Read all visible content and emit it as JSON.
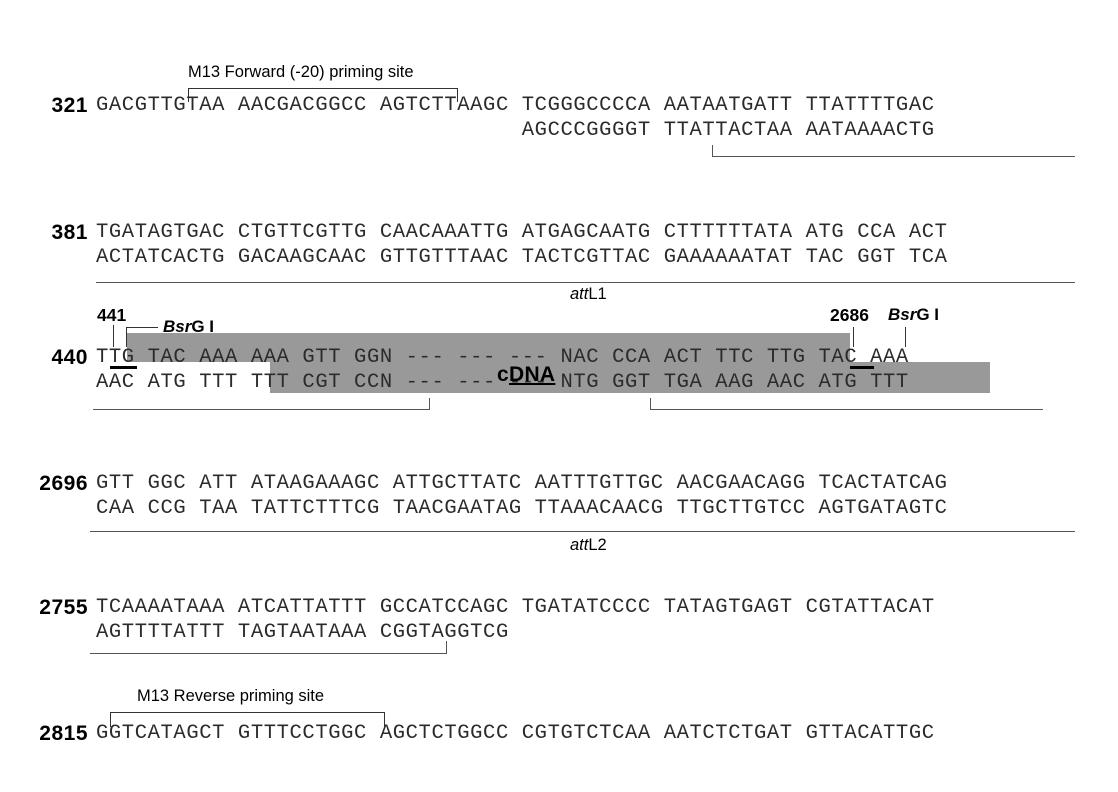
{
  "figure": {
    "type": "dna-sequence-map",
    "highlight_color": "#999999",
    "text_color": "#2b2b2b"
  },
  "annotations": {
    "m13_forward": "M13 Forward (-20) priming site",
    "m13_reverse": "M13 Reverse priming site",
    "attL1": {
      "italic": "att",
      "plain": "L1"
    },
    "attL2": {
      "italic": "att",
      "plain": "L2"
    },
    "bsrg1_left": {
      "italic": "Bsr",
      "plain": "G I"
    },
    "bsrg1_right": {
      "italic": "Bsr",
      "plain": "G I"
    },
    "pos_441": "441",
    "pos_2686": "2686",
    "cdna_label": "cDNA"
  },
  "rows": [
    {
      "number": "321",
      "top": "GACGTTGTAA AACGACGGCC AGTCTTAAGC TCGGGCCCCA AATAATGATT TTATTTTGAC",
      "bottom": "                                 AGCCCGGGGT TTATTACTAA AATAAAACTG"
    },
    {
      "number": "381",
      "top": "TGATAGTGAC CTGTTCGTTG CAACAAATTG ATGAGCAATG CTTTTTTATA ATG CCA ACT",
      "bottom": "ACTATCACTG GACAAGCAAC GTTGTTTAAC TACTCGTTAC GAAAAAATAT TAC GGT TCA"
    },
    {
      "number": "440",
      "top": "TTG TAC AAA AAA GTT GGN --- --- --- NAC CCA ACT TTC TTG TAC AAA",
      "bottom": "AAC ATG TTT TTT CGT CCN --- --- --- NTG GGT TGA AAG AAC ATG TTT"
    },
    {
      "number": "2696",
      "top": "GTT GGC ATT ATAAGAAAGC ATTGCTTATC AATTTGTTGC AACGAACAGG TCACTATCAG",
      "bottom": "CAA CCG TAA TATTCTTTCG TAACGAATAG TTAAACAACG TTGCTTGTCC AGTGATAGTC"
    },
    {
      "number": "2755",
      "top": "TCAAAATAAA ATCATTATTT GCCATCCAGC TGATATCCCC TATAGTGAGT CGTATTACAT",
      "bottom": "AGTTTTATTT TAGTAATAAA CGGTAGGTCG"
    },
    {
      "number": "2815",
      "top": "GGTCATAGCT GTTTCCTGGC AGCTCTGGCC CGTGTCTCAA AATCTCTGAT GTTACATTGC",
      "bottom": ""
    }
  ]
}
